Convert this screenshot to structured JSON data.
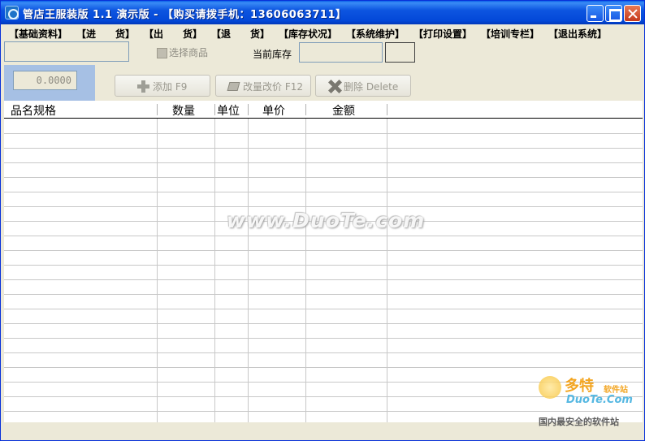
{
  "window": {
    "title": "管店王服装版  1.1  演示版  -  【购买请拨手机：13606063711】"
  },
  "menu": [
    "【基础资料】",
    "【进　　货】",
    "【出　　货】",
    "【退　　货】",
    "【库存状况】",
    "【系统维护】",
    "【打印设置】",
    "【培训专栏】",
    "【退出系统】"
  ],
  "controls": {
    "product_code_value": "",
    "select_product_label": "选择商品",
    "current_stock_label": "当前库存",
    "current_stock_value": "",
    "amount_value": "0.0000"
  },
  "buttons": {
    "add": "添加 F9",
    "edit": "改量改价 F12",
    "delete": "删除 Delete"
  },
  "grid": {
    "columns": [
      "品名规格",
      "数量",
      "单位",
      "单价",
      "金额"
    ],
    "rows": []
  },
  "watermark": {
    "text": "www.DuoTe.com",
    "logo_cn": "多特",
    "logo_cn_small": "软件站",
    "logo_en": "DuoTe.Com",
    "logo_tag": "国内最安全的软件站"
  },
  "icons": {
    "app": "app-icon",
    "minimize": "minimize-icon",
    "maximize": "maximize-icon",
    "close": "close-icon",
    "add": "plus-icon",
    "edit": "pencil-icon",
    "delete": "x-icon"
  }
}
